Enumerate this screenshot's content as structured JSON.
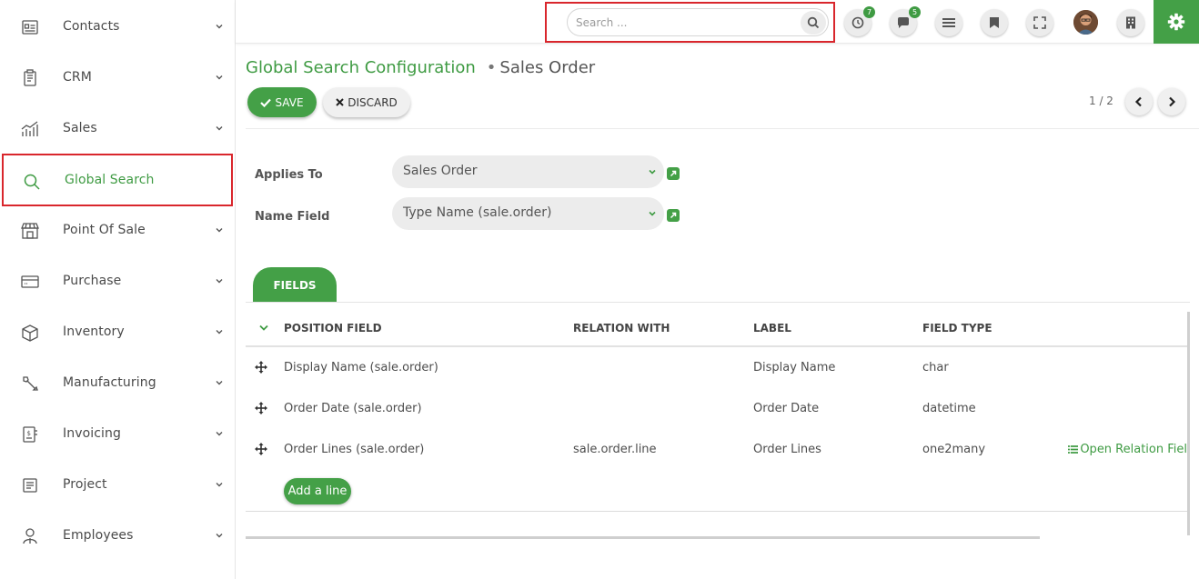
{
  "sidebar": {
    "items": [
      {
        "label": "Contacts",
        "icon": "contacts-icon"
      },
      {
        "label": "CRM",
        "icon": "crm-icon"
      },
      {
        "label": "Sales",
        "icon": "sales-chart-icon"
      },
      {
        "label": "Global Search",
        "icon": "search-icon"
      },
      {
        "label": "Point Of Sale",
        "icon": "store-icon"
      },
      {
        "label": "Purchase",
        "icon": "credit-card-icon"
      },
      {
        "label": "Inventory",
        "icon": "box-icon"
      },
      {
        "label": "Manufacturing",
        "icon": "wrench-icon"
      },
      {
        "label": "Invoicing",
        "icon": "invoice-icon"
      },
      {
        "label": "Project",
        "icon": "project-icon"
      },
      {
        "label": "Employees",
        "icon": "employees-icon"
      }
    ],
    "active": "Global Search"
  },
  "topbar": {
    "search_placeholder": "Search ...",
    "activity_badge": "7",
    "messages_badge": "5"
  },
  "breadcrumb": {
    "parent": "Global Search Configuration",
    "current": "Sales Order"
  },
  "actions": {
    "save_label": "SAVE",
    "discard_label": "DISCARD"
  },
  "pager": {
    "text": "1 / 2"
  },
  "form": {
    "applies_to_label": "Applies To",
    "applies_to_value": "Sales Order",
    "name_field_label": "Name Field",
    "name_field_value": "Type Name (sale.order)"
  },
  "tabs": [
    {
      "label": "FIELDS"
    }
  ],
  "table": {
    "columns": [
      "POSITION FIELD",
      "RELATION WITH",
      "LABEL",
      "FIELD TYPE"
    ],
    "rows": [
      {
        "position_field": "Display Name (sale.order)",
        "relation_with": "",
        "label": "Display Name",
        "field_type": "char"
      },
      {
        "position_field": "Order Date (sale.order)",
        "relation_with": "",
        "label": "Order Date",
        "field_type": "datetime"
      },
      {
        "position_field": "Order Lines (sale.order)",
        "relation_with": "sale.order.line",
        "label": "Order Lines",
        "field_type": "one2many",
        "action": "Open Relation Fiel"
      }
    ],
    "add_line_label": "Add a line"
  },
  "colors": {
    "accent": "#44a047",
    "highlight_border": "#d9262c"
  }
}
